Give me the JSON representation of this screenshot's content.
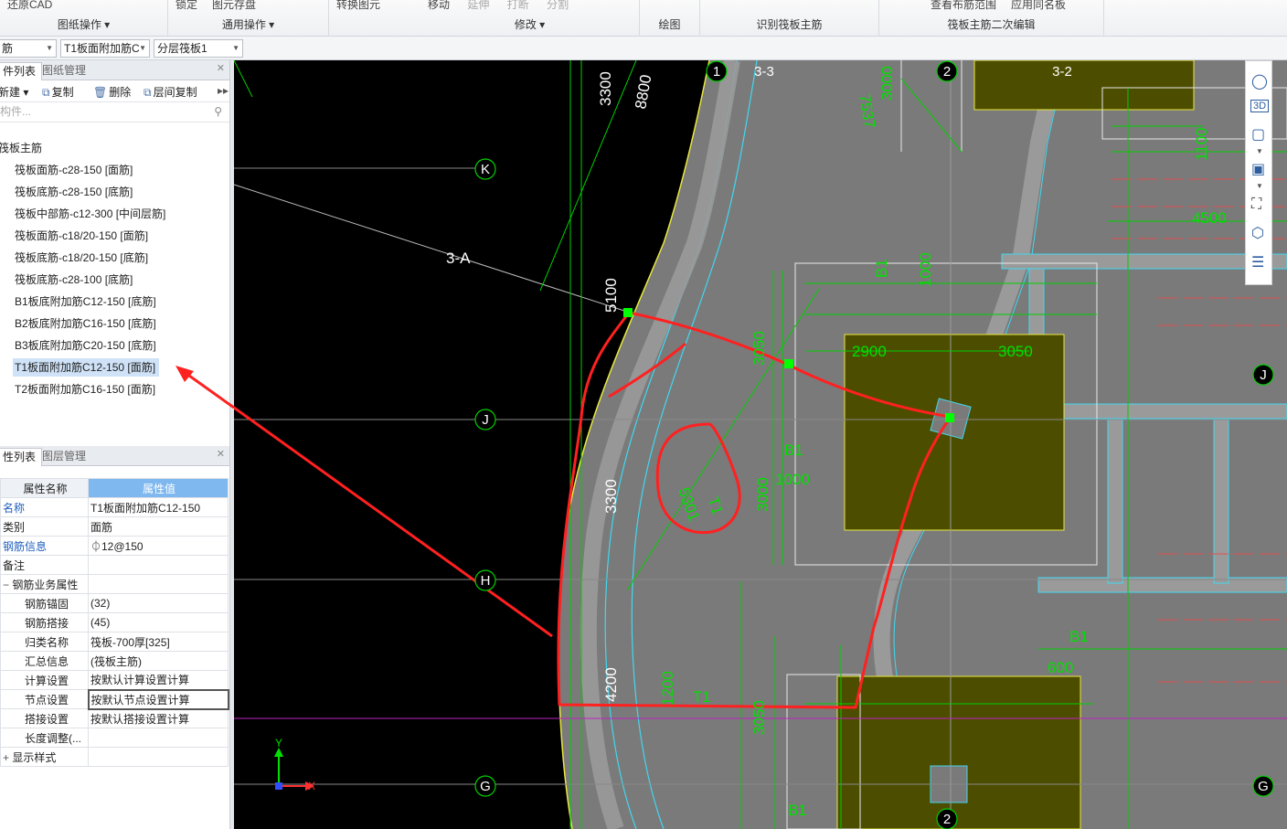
{
  "ribbon": {
    "groups": [
      {
        "tools": [
          "还原CAD"
        ],
        "label": "图纸操作"
      },
      {
        "tools": [
          "锁定",
          "图元存盘"
        ],
        "label": "通用操作"
      },
      {
        "tools": [
          "转换图元"
        ],
        "label": ""
      },
      {
        "tools": [
          "移动",
          "延伸",
          "打断",
          "分割"
        ],
        "label": "修改"
      },
      {
        "tools": [],
        "label": "绘图"
      },
      {
        "tools": [],
        "label": "识别筏板主筋"
      },
      {
        "tools": [
          "查看布筋范围",
          "应用同名板"
        ],
        "label": "筏板主筋二次编辑"
      }
    ]
  },
  "toolbar": {
    "combo1": "筋",
    "combo2": "T1板面附加筋C",
    "combo3": "分层筏板1"
  },
  "component_panel": {
    "tab_active": "件列表",
    "tab_other": "图纸管理",
    "btn_new": "新建",
    "btn_copy": "复制",
    "btn_delete": "删除",
    "btn_layer_copy": "层间复制",
    "search_placeholder": "构件...",
    "tree_root": "筏板主筋",
    "tree_items": [
      "筏板面筋-c28-150 [面筋]",
      "筏板底筋-c28-150 [底筋]",
      "筏板中部筋-c12-300 [中间层筋]",
      "筏板面筋-c18/20-150 [面筋]",
      "筏板底筋-c18/20-150 [底筋]",
      "筏板底筋-c28-100 [底筋]",
      "B1板底附加筋C12-150 [底筋]",
      "B2板底附加筋C16-150 [底筋]",
      "B3板底附加筋C20-150 [底筋]",
      "T1板面附加筋C12-150 [面筋]",
      "T2板面附加筋C16-150 [面筋]"
    ],
    "selected_index": 9
  },
  "property_panel": {
    "tab_active": "性列表",
    "tab_other": "图层管理",
    "col_name": "属性名称",
    "col_value": "属性值",
    "rows": [
      {
        "name": "名称",
        "value": "T1板面附加筋C12-150",
        "blue": true
      },
      {
        "name": "类别",
        "value": "面筋",
        "blue": false
      },
      {
        "name": "钢筋信息",
        "value": "⏀12@150",
        "blue": true
      },
      {
        "name": "备注",
        "value": "",
        "blue": false
      },
      {
        "name": "钢筋业务属性",
        "value": "",
        "group": true
      },
      {
        "name": "钢筋锚固",
        "value": "(32)",
        "indent": true
      },
      {
        "name": "钢筋搭接",
        "value": "(45)",
        "indent": true
      },
      {
        "name": "归类名称",
        "value": "筏板-700厚[325]",
        "indent": true
      },
      {
        "name": "汇总信息",
        "value": "(筏板主筋)",
        "indent": true
      },
      {
        "name": "计算设置",
        "value": "按默认计算设置计算",
        "indent": true
      },
      {
        "name": "节点设置",
        "value": "按默认节点设置计算",
        "indent": true,
        "boxed": true
      },
      {
        "name": "搭接设置",
        "value": "按默认搭接设置计算",
        "indent": true
      },
      {
        "name": "长度调整(...",
        "value": "",
        "indent": true
      },
      {
        "name": "显示样式",
        "value": "",
        "group": true
      }
    ]
  },
  "cad": {
    "axis_bubbles": [
      "1",
      "3-3",
      "2",
      "3-2",
      "K",
      "J",
      "H",
      "G",
      "J",
      "G",
      "2"
    ],
    "labels": [
      "3300",
      "8800",
      "3000",
      "1100",
      "4500",
      "3-A",
      "5100",
      "B1",
      "1000",
      "2900",
      "3050",
      "3050",
      "B1",
      "1000",
      "3000",
      "5301",
      "T1",
      "3300",
      "4200",
      "1200",
      "T1",
      "3050",
      "B1",
      "600",
      "B1",
      "7537"
    ],
    "ucs_x": "X",
    "ucs_y": "Y"
  },
  "colors": {
    "cad_bg": "#000000",
    "plate": "#7a7a7a",
    "green": "#00d000",
    "yellow": "#e8e840",
    "cyan": "#40d8f0",
    "red_markup": "#ff2020",
    "selection": "#cfe2f7"
  }
}
